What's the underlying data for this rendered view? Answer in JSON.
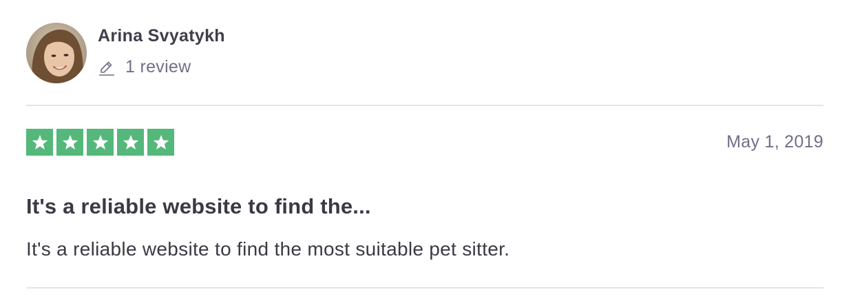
{
  "reviewer": {
    "name": "Arina Svyatykh",
    "review_count_label": "1 review",
    "avatar_icon": "avatar-photo",
    "count_icon": "pencil-icon"
  },
  "review": {
    "rating": 5,
    "rating_max": 5,
    "star_color": "#54b87a",
    "date": "May 1, 2019",
    "title": "It's a reliable website to find the...",
    "body": "It's a reliable website to find the most suitable pet sitter."
  }
}
